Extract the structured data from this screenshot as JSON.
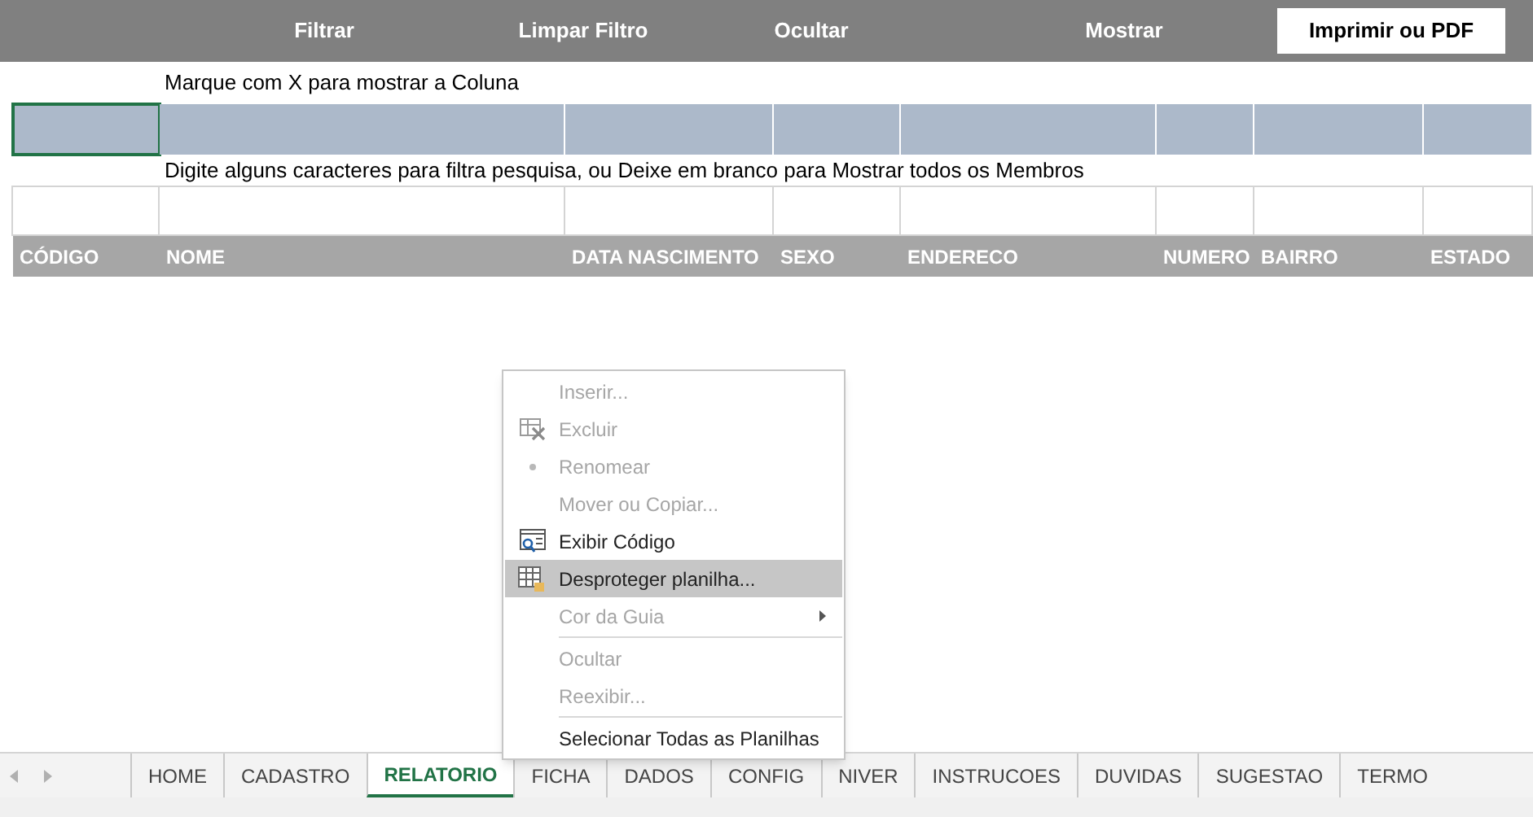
{
  "toolbar": {
    "buttons": [
      {
        "label": "Filtrar",
        "kind": "plain"
      },
      {
        "label": "Limpar Filtro",
        "kind": "plain"
      },
      {
        "label": "Ocultar",
        "kind": "plain"
      },
      {
        "label": "Mostrar",
        "kind": "plain"
      },
      {
        "label": "Imprimir ou PDF",
        "kind": "primary"
      }
    ]
  },
  "mark_row": {
    "label": "Marque com X para mostrar a Coluna",
    "cells": [
      {
        "selected": true
      },
      {
        "selected": false
      },
      {
        "selected": false
      },
      {
        "selected": false
      },
      {
        "selected": false
      },
      {
        "selected": false
      },
      {
        "selected": false
      },
      {
        "selected": false
      }
    ]
  },
  "filter_row": {
    "label": "Digite alguns caracteres para filtra pesquisa, ou Deixe em branco para Mostrar todos os Membros"
  },
  "table": {
    "columns": [
      "CÓDIGO",
      "NOME",
      "DATA NASCIMENTO",
      "SEXO",
      "ENDERECO",
      "NUMERO",
      "BAIRRO",
      "ESTADO"
    ]
  },
  "context_menu": {
    "items": [
      {
        "label": "Inserir...",
        "disabled": true,
        "submenu": false,
        "selected": false,
        "separator_before": false
      },
      {
        "label": "Excluir",
        "disabled": true,
        "submenu": false,
        "selected": false,
        "separator_before": false
      },
      {
        "label": "Renomear",
        "disabled": true,
        "submenu": false,
        "selected": false,
        "separator_before": false
      },
      {
        "label": "Mover ou Copiar...",
        "disabled": true,
        "submenu": false,
        "selected": false,
        "separator_before": false
      },
      {
        "label": "Exibir Código",
        "disabled": false,
        "submenu": false,
        "selected": false,
        "separator_before": false
      },
      {
        "label": "Desproteger planilha...",
        "disabled": false,
        "submenu": false,
        "selected": true,
        "separator_before": false
      },
      {
        "label": "Cor da Guia",
        "disabled": true,
        "submenu": true,
        "selected": false,
        "separator_before": false
      },
      {
        "label": "Ocultar",
        "disabled": true,
        "submenu": false,
        "selected": false,
        "separator_before": true
      },
      {
        "label": "Reexibir...",
        "disabled": true,
        "submenu": false,
        "selected": false,
        "separator_before": false
      },
      {
        "label": "Selecionar Todas as Planilhas",
        "disabled": false,
        "submenu": false,
        "selected": false,
        "separator_before": true
      }
    ]
  },
  "sheet_tabs": [
    {
      "label": "HOME",
      "selected": false
    },
    {
      "label": "CADASTRO",
      "selected": false
    },
    {
      "label": "RELATORIO",
      "selected": true
    },
    {
      "label": "FICHA",
      "selected": false
    },
    {
      "label": "DADOS",
      "selected": false
    },
    {
      "label": "CONFIG",
      "selected": false
    },
    {
      "label": "NIVER",
      "selected": false
    },
    {
      "label": "INSTRUCOES",
      "selected": false
    },
    {
      "label": "DUVIDAS",
      "selected": false
    },
    {
      "label": "SUGESTAO",
      "selected": false
    },
    {
      "label": "TERMO",
      "selected": false
    }
  ]
}
